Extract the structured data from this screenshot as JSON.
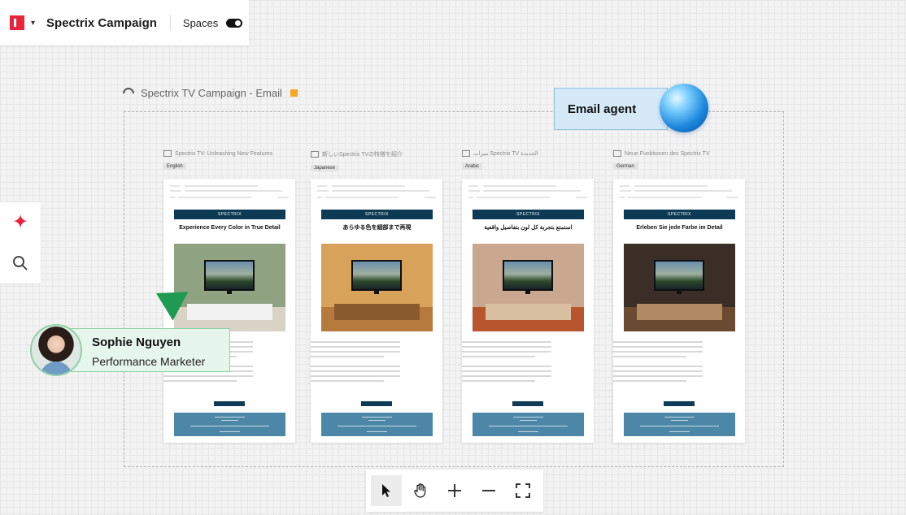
{
  "app": {
    "title": "Spectrix Campaign",
    "spaces_label": "Spaces",
    "spaces_enabled": true
  },
  "sidebar_tools": [
    {
      "name": "ai-sparkle-icon"
    },
    {
      "name": "search-icon"
    }
  ],
  "campaign": {
    "title": "Spectrix TV Campaign - Email",
    "status_color": "#f5a623"
  },
  "agent": {
    "label": "Email agent"
  },
  "collaborator": {
    "name": "Sophie Nguyen",
    "role": "Performance Marketer",
    "cursor_color": "#1f9a52"
  },
  "emails": [
    {
      "subject": "Spectrix TV: Unleashing New Features",
      "language": "English",
      "brand": "SPECTRIX",
      "headline": "Experience Every Color in True Detail",
      "room": {
        "wall": "#8fa383",
        "floor": "#d9d3c5",
        "furniture": "#f2f2f2"
      }
    },
    {
      "subject": "新しいSpectrix TVの特徴を紹介",
      "language": "Japanese",
      "brand": "SPECTRIX",
      "headline": "あらゆる色を細部まで再現",
      "room": {
        "wall": "#d9a25a",
        "floor": "#b57a3c",
        "furniture": "#8a5a2f"
      }
    },
    {
      "subject": "ميزات Spectrix TV الجديدة",
      "language": "Arabic",
      "brand": "SPECTRIX",
      "headline": "استمتع بتجربة كل لون بتفاصيل واقعية",
      "room": {
        "wall": "#c9a88f",
        "floor": "#b8552e",
        "furniture": "#d8c0a0"
      }
    },
    {
      "subject": "Neue Funktionen des Spectrix TV",
      "language": "German",
      "brand": "SPECTRIX",
      "headline": "Erleben Sie jede Farbe im Detail",
      "room": {
        "wall": "#3a2e26",
        "floor": "#6b4a32",
        "furniture": "#b08a63"
      }
    }
  ],
  "bottom_tools": [
    {
      "name": "select-cursor-icon",
      "active": true
    },
    {
      "name": "hand-pan-icon",
      "active": false
    },
    {
      "name": "zoom-in-icon",
      "active": false
    },
    {
      "name": "zoom-out-icon",
      "active": false
    },
    {
      "name": "fit-screen-icon",
      "active": false
    }
  ]
}
